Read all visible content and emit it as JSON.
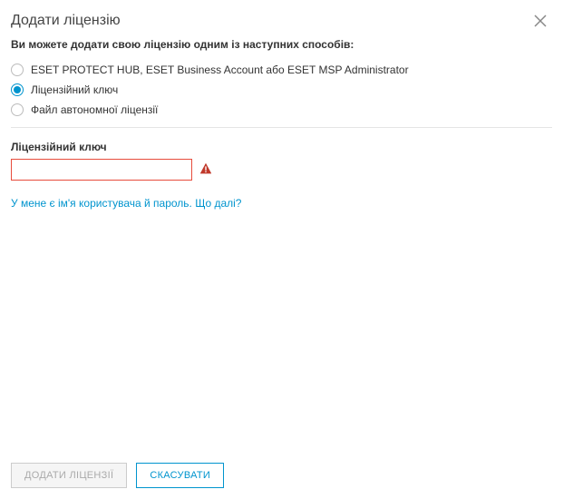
{
  "header": {
    "title": "Додати ліцензію"
  },
  "intro": "Ви можете додати свою ліцензію одним із наступних способів:",
  "options": {
    "hub": "ESET PROTECT HUB, ESET Business Account або ESET MSP Administrator",
    "key": "Ліцензійний ключ",
    "offline": "Файл автономної ліцензії"
  },
  "field": {
    "label": "Ліцензійний ключ",
    "value": ""
  },
  "help_link": "У мене є ім'я користувача й пароль. Що далі?",
  "footer": {
    "add": "ДОДАТИ ЛІЦЕНЗІЇ",
    "cancel": "СКАСУВАТИ"
  }
}
